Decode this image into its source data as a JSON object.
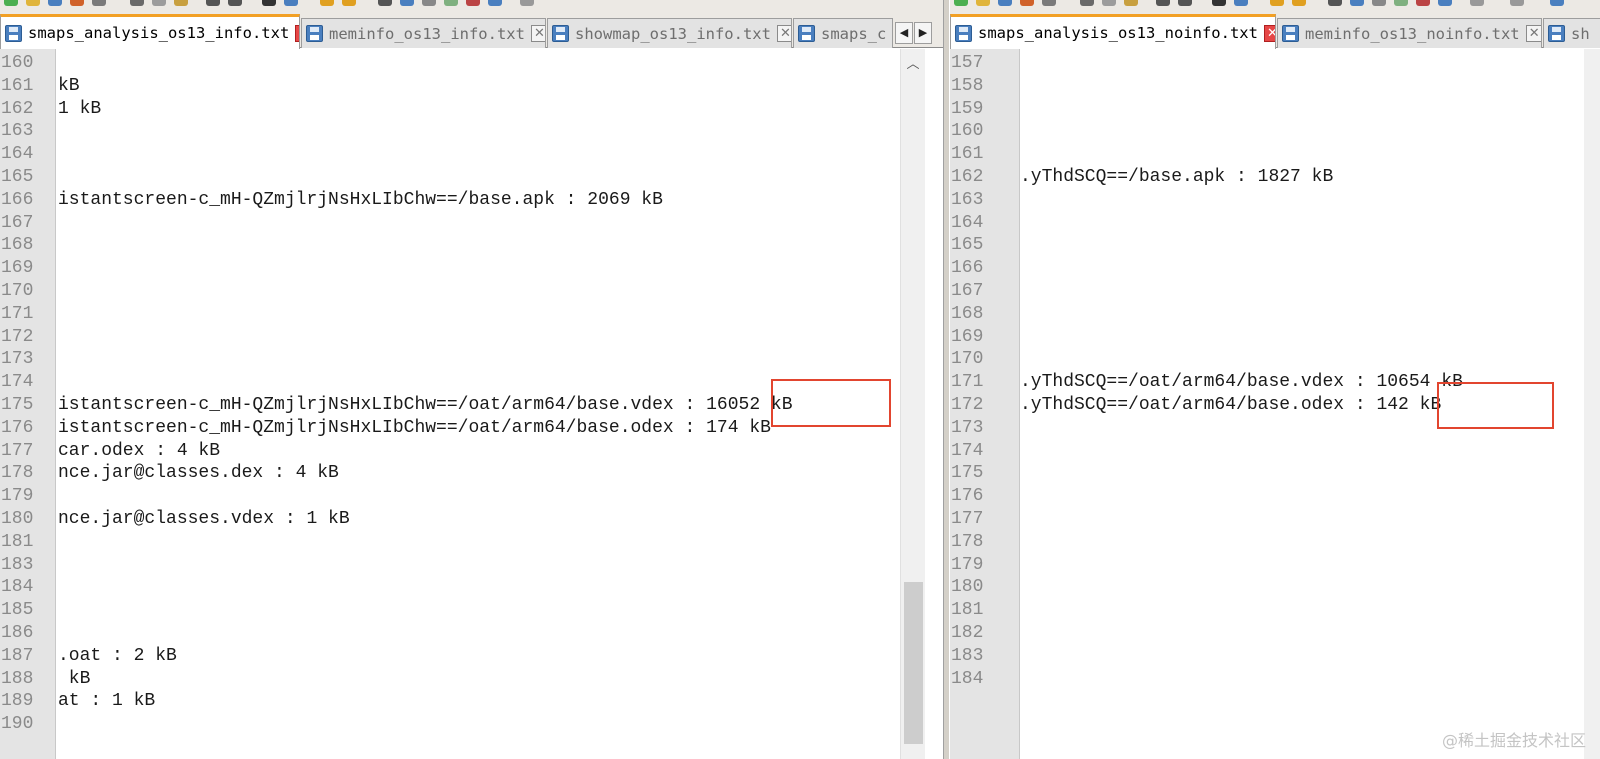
{
  "left": {
    "tabs": [
      {
        "label": "smaps_analysis_os13_info.txt",
        "active": true
      },
      {
        "label": "meminfo_os13_info.txt",
        "active": false
      },
      {
        "label": "showmap_os13_info.txt",
        "active": false
      },
      {
        "label": "smaps_c",
        "active": false
      }
    ],
    "lines": [
      {
        "n": "160",
        "t": ""
      },
      {
        "n": "161",
        "t": "kB"
      },
      {
        "n": "162",
        "t": "1 kB"
      },
      {
        "n": "163",
        "t": ""
      },
      {
        "n": "164",
        "t": ""
      },
      {
        "n": "165",
        "t": ""
      },
      {
        "n": "166",
        "t": "istantscreen-c_mH-QZmjlrjNsHxLIbChw==/base.apk : 2069 kB"
      },
      {
        "n": "167",
        "t": ""
      },
      {
        "n": "168",
        "t": ""
      },
      {
        "n": "169",
        "t": ""
      },
      {
        "n": "170",
        "t": ""
      },
      {
        "n": "171",
        "t": ""
      },
      {
        "n": "172",
        "t": ""
      },
      {
        "n": "173",
        "t": ""
      },
      {
        "n": "174",
        "t": ""
      },
      {
        "n": "175",
        "t": "istantscreen-c_mH-QZmjlrjNsHxLIbChw==/oat/arm64/base.vdex : 16052 kB"
      },
      {
        "n": "176",
        "t": "istantscreen-c_mH-QZmjlrjNsHxLIbChw==/oat/arm64/base.odex : 174 kB"
      },
      {
        "n": "177",
        "t": "car.odex : 4 kB"
      },
      {
        "n": "178",
        "t": "nce.jar@classes.dex : 4 kB"
      },
      {
        "n": "179",
        "t": ""
      },
      {
        "n": "180",
        "t": "nce.jar@classes.vdex : 1 kB"
      },
      {
        "n": "181",
        "t": ""
      },
      {
        "n": "183",
        "t": ""
      },
      {
        "n": "184",
        "t": ""
      },
      {
        "n": "185",
        "t": ""
      },
      {
        "n": "186",
        "t": ""
      },
      {
        "n": "187",
        "t": ".oat : 2 kB"
      },
      {
        "n": "188",
        "t": " kB"
      },
      {
        "n": "189",
        "t": "at : 1 kB"
      },
      {
        "n": "190",
        "t": ""
      }
    ],
    "highlighted_value": "16052 kB"
  },
  "right": {
    "tabs": [
      {
        "label": "smaps_analysis_os13_noinfo.txt",
        "active": true
      },
      {
        "label": "meminfo_os13_noinfo.txt",
        "active": false
      },
      {
        "label": "sh",
        "active": false
      }
    ],
    "lines": [
      {
        "n": "157",
        "t": ""
      },
      {
        "n": "158",
        "t": ""
      },
      {
        "n": "159",
        "t": ""
      },
      {
        "n": "160",
        "t": ""
      },
      {
        "n": "161",
        "t": ""
      },
      {
        "n": "162",
        "t": ".yThdSCQ==/base.apk : 1827 kB"
      },
      {
        "n": "163",
        "t": ""
      },
      {
        "n": "164",
        "t": ""
      },
      {
        "n": "165",
        "t": ""
      },
      {
        "n": "166",
        "t": ""
      },
      {
        "n": "167",
        "t": ""
      },
      {
        "n": "168",
        "t": ""
      },
      {
        "n": "169",
        "t": ""
      },
      {
        "n": "170",
        "t": ""
      },
      {
        "n": "171",
        "t": ".yThdSCQ==/oat/arm64/base.vdex : 10654 kB"
      },
      {
        "n": "172",
        "t": ".yThdSCQ==/oat/arm64/base.odex : 142 kB"
      },
      {
        "n": "173",
        "t": ""
      },
      {
        "n": "174",
        "t": ""
      },
      {
        "n": "175",
        "t": ""
      },
      {
        "n": "176",
        "t": ""
      },
      {
        "n": "177",
        "t": ""
      },
      {
        "n": "178",
        "t": ""
      },
      {
        "n": "179",
        "t": ""
      },
      {
        "n": "180",
        "t": ""
      },
      {
        "n": "181",
        "t": ""
      },
      {
        "n": "182",
        "t": ""
      },
      {
        "n": "183",
        "t": ""
      },
      {
        "n": "184",
        "t": ""
      }
    ],
    "highlighted_value": "10654 kB"
  },
  "scroll": {
    "up_icon": "chevron-up-icon",
    "nav_left_icon": "triangle-left-icon",
    "nav_right_icon": "triangle-right-icon"
  },
  "watermark": "@稀土掘金技术社区",
  "colors": {
    "accent_tab": "#f2a024",
    "highlight_box": "#e2452f",
    "gutter": "#e4e4e4"
  }
}
